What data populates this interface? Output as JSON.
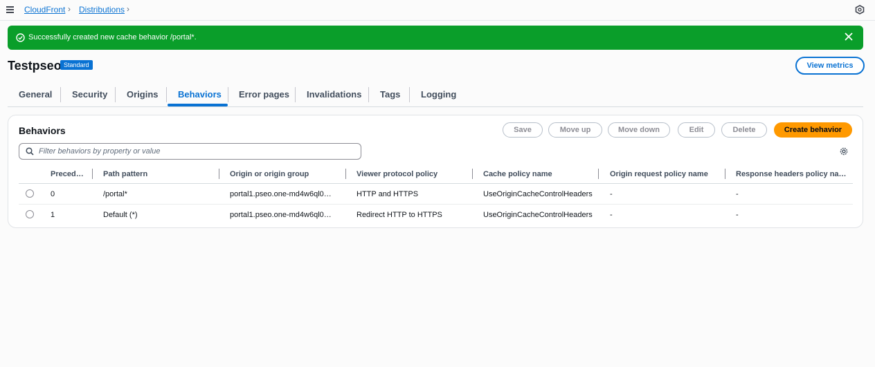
{
  "breadcrumbs": [
    "CloudFront",
    "Distributions"
  ],
  "flash": {
    "message": "Successfully created new cache behavior /portal*.",
    "color": "#0a9e2a"
  },
  "header": {
    "title": "Testpseo",
    "badge": "Standard",
    "view_metrics": "View metrics"
  },
  "tabs": [
    {
      "label": "General",
      "active": false
    },
    {
      "label": "Security",
      "active": false
    },
    {
      "label": "Origins",
      "active": false
    },
    {
      "label": "Behaviors",
      "active": true
    },
    {
      "label": "Error pages",
      "active": false
    },
    {
      "label": "Invalidations",
      "active": false
    },
    {
      "label": "Tags",
      "active": false
    },
    {
      "label": "Logging",
      "active": false
    }
  ],
  "panel": {
    "title": "Behaviors",
    "buttons": {
      "save": "Save",
      "move_up": "Move up",
      "move_down": "Move down",
      "edit": "Edit",
      "delete": "Delete",
      "create": "Create behavior"
    },
    "search_placeholder": "Filter behaviors by property or value",
    "columns": [
      "Preced…",
      "Path pattern",
      "Origin or origin group",
      "Viewer protocol policy",
      "Cache policy name",
      "Origin request policy name",
      "Response headers policy na…"
    ],
    "rows": [
      [
        "0",
        "/portal*",
        "portal1.pseo.one-md4w6ql0…",
        "HTTP and HTTPS",
        "UseOriginCacheControlHeaders",
        "-",
        "-"
      ],
      [
        "1",
        "Default (*)",
        "portal1.pseo.one-md4w6ql0…",
        "Redirect HTTP to HTTPS",
        "UseOriginCacheControlHeaders",
        "-",
        "-"
      ]
    ]
  },
  "colors": {
    "accent": "#0972d3",
    "primary_button": "#ff9900"
  }
}
